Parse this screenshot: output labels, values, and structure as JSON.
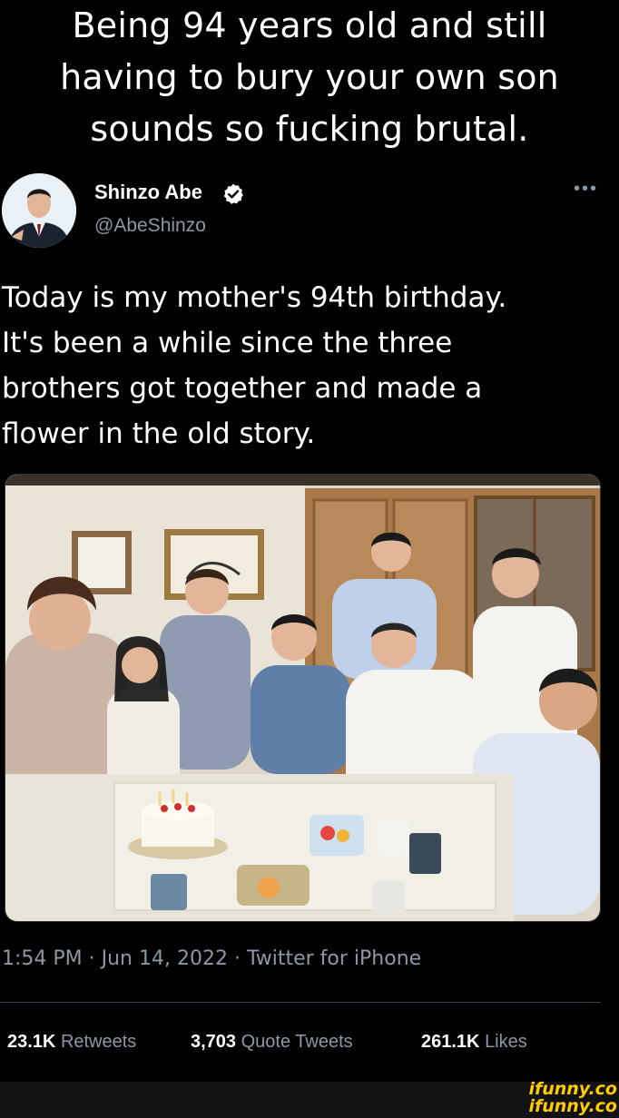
{
  "caption": {
    "lines": [
      "Being 94 years old and still",
      "having to bury your own son",
      "sounds so fucking brutal."
    ]
  },
  "tweet": {
    "author": {
      "name": "Shinzo Abe",
      "handle": "@AbeShinzo",
      "verified_icon": "verified-badge-icon",
      "avatar_icon": "profile-avatar"
    },
    "more_label": "•••",
    "text_lines": [
      "Today is my mother's 94th birthday.",
      "It's been a while since the three",
      "brothers got together and made a",
      "flower in the old story."
    ],
    "timestamp": "1:54 PM · Jun 14, 2022 · Twitter for iPhone",
    "stats": {
      "retweets": {
        "count": "23.1K",
        "label": "Retweets"
      },
      "quotes": {
        "count": "3,703",
        "label": "Quote Tweets"
      },
      "likes": {
        "count": "261.1K",
        "label": "Likes"
      }
    }
  },
  "watermark": {
    "line1": "ifunny.co",
    "line2": "ifunny.co"
  },
  "colors": {
    "background": "#000000",
    "muted": "#8b98a5",
    "verified": "#ffffff",
    "watermark": "#ffcc00"
  }
}
